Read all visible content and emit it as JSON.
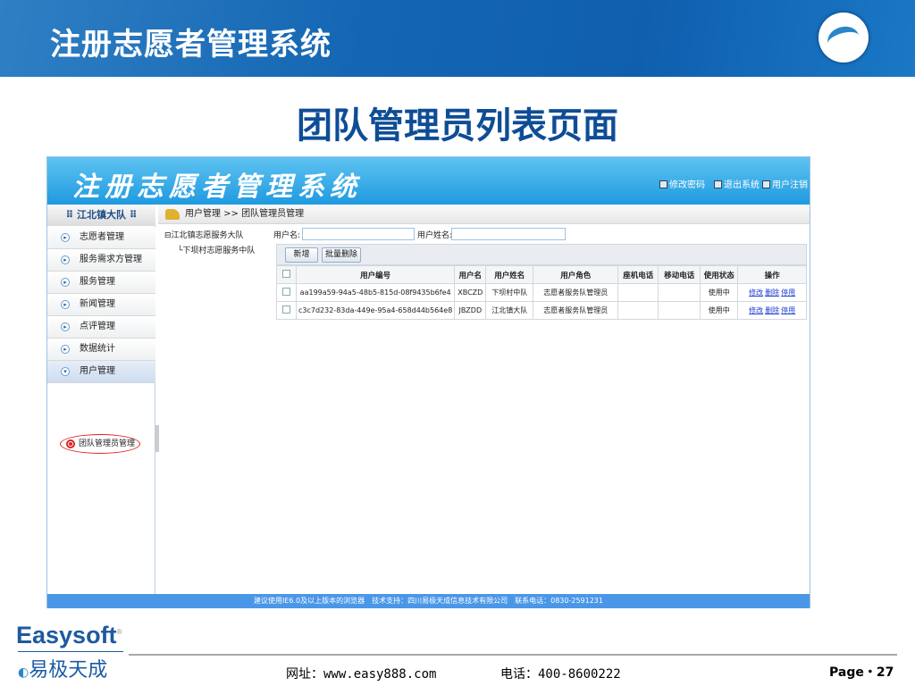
{
  "slide": {
    "title": "注册志愿者管理系统",
    "heading": "团队管理员列表页面",
    "page": "Page・27"
  },
  "footer": {
    "brand_en": "Easysoft",
    "brand_reg": "®",
    "brand_cn": "易极天成",
    "website": "网址：www.easy888.com",
    "phone": "电话：400-8600222"
  },
  "app": {
    "title": "注册志愿者管理系统",
    "top_links": [
      "修改密码",
      "退出系统",
      "用户注销"
    ],
    "sidebar": {
      "header": "江北镇大队",
      "items": [
        "志愿者管理",
        "服务需求方管理",
        "服务管理",
        "新闻管理",
        "点评管理",
        "数据统计",
        "用户管理"
      ],
      "sub_item": "团队管理员管理"
    },
    "breadcrumb": "用户管理 >> 团队管理员管理",
    "tree": {
      "root": "江北镇志愿服务大队",
      "child": "下坝村志愿服务中队"
    },
    "search": {
      "username_label": "用户名:",
      "username_value": "",
      "realname_label": "用户姓名:",
      "realname_value": ""
    },
    "buttons": {
      "add": "新增",
      "batch_delete": "批量删除"
    },
    "table": {
      "headers": [
        "用户编号",
        "用户名",
        "用户姓名",
        "用户角色",
        "座机电话",
        "移动电话",
        "使用状态",
        "操作"
      ],
      "rows": [
        {
          "id": "aa199a59-94a5-48b5-815d-08f9435b6fe4",
          "username": "XBCZD",
          "name": "下坝村中队",
          "role": "志愿者服务队管理员",
          "landline": "",
          "mobile": "",
          "status": "使用中"
        },
        {
          "id": "c3c7d232-83da-449e-95a4-658d44b564e8",
          "username": "JBZDD",
          "name": "江北镇大队",
          "role": "志愿者服务队管理员",
          "landline": "",
          "mobile": "",
          "status": "使用中"
        }
      ],
      "actions": [
        "修改",
        "删除",
        "停用"
      ]
    },
    "footer": "建议使用IE6.0及以上版本的浏览器　技术支持：四川易极天成信息技术有限公司　联系电话：0830-2591231"
  }
}
